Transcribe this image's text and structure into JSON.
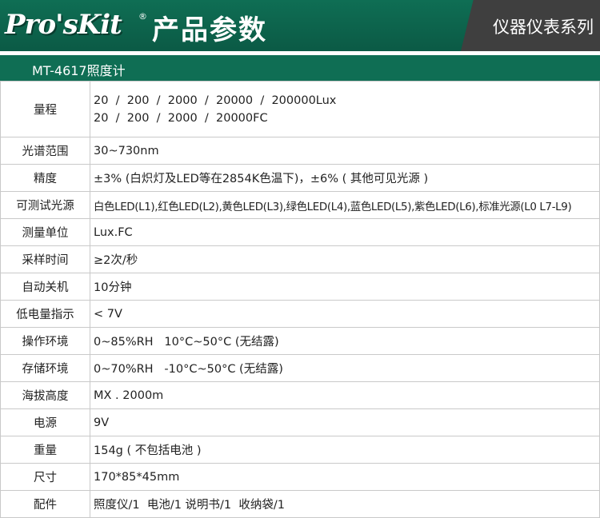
{
  "header": {
    "brand": "Pro'sKit",
    "brand_mark": "®",
    "title": "产品参数",
    "series": "仪器仪表系列",
    "colors": {
      "brand_green": "#0f6e54",
      "series_bg": "#3f3f3f",
      "text_white": "#ffffff"
    }
  },
  "product": {
    "title": "MT-4617照度计"
  },
  "specs": {
    "range": {
      "label": "量程",
      "line1": "20  /  200  /  2000  /  20000  /  200000Lux",
      "line2": "20  /  200  /  2000  /  20000FC"
    },
    "spectrum": {
      "label": "光谱范围",
      "value": "30~730nm"
    },
    "accuracy": {
      "label": "精度",
      "value": "±3% (白炽灯及LED等在2854K色温下)，±6% ( 其他可见光源 )"
    },
    "light_sources": {
      "label": "可测试光源",
      "value": "白色LED(L1),红色LED(L2),黄色LED(L3),绿色LED(L4),蓝色LED(L5),紫色LED(L6),标准光源(L0 L7-L9)"
    },
    "unit": {
      "label": "测量单位",
      "value": "Lux.FC"
    },
    "sampling": {
      "label": "采样时间",
      "value": "≥2次/秒"
    },
    "auto_off": {
      "label": "自动关机",
      "value": "10分钟"
    },
    "low_battery": {
      "label": "低电量指示",
      "value": "< 7V"
    },
    "operating_env": {
      "label": "操作环境",
      "value": "0~85%RH   10°C~50°C (无结露)"
    },
    "storage_env": {
      "label": "存储环境",
      "value": "0~70%RH   -10°C~50°C (无结露)"
    },
    "altitude": {
      "label": "海拔高度",
      "value": "MX . 2000m"
    },
    "power": {
      "label": "电源",
      "value": "9V"
    },
    "weight": {
      "label": "重量",
      "value": "154g ( 不包括电池 )"
    },
    "size": {
      "label": "尺寸",
      "value": "170*85*45mm"
    },
    "accessories": {
      "label": "配件",
      "value": "照度仪/1  电池/1 说明书/1  收纳袋/1"
    }
  }
}
